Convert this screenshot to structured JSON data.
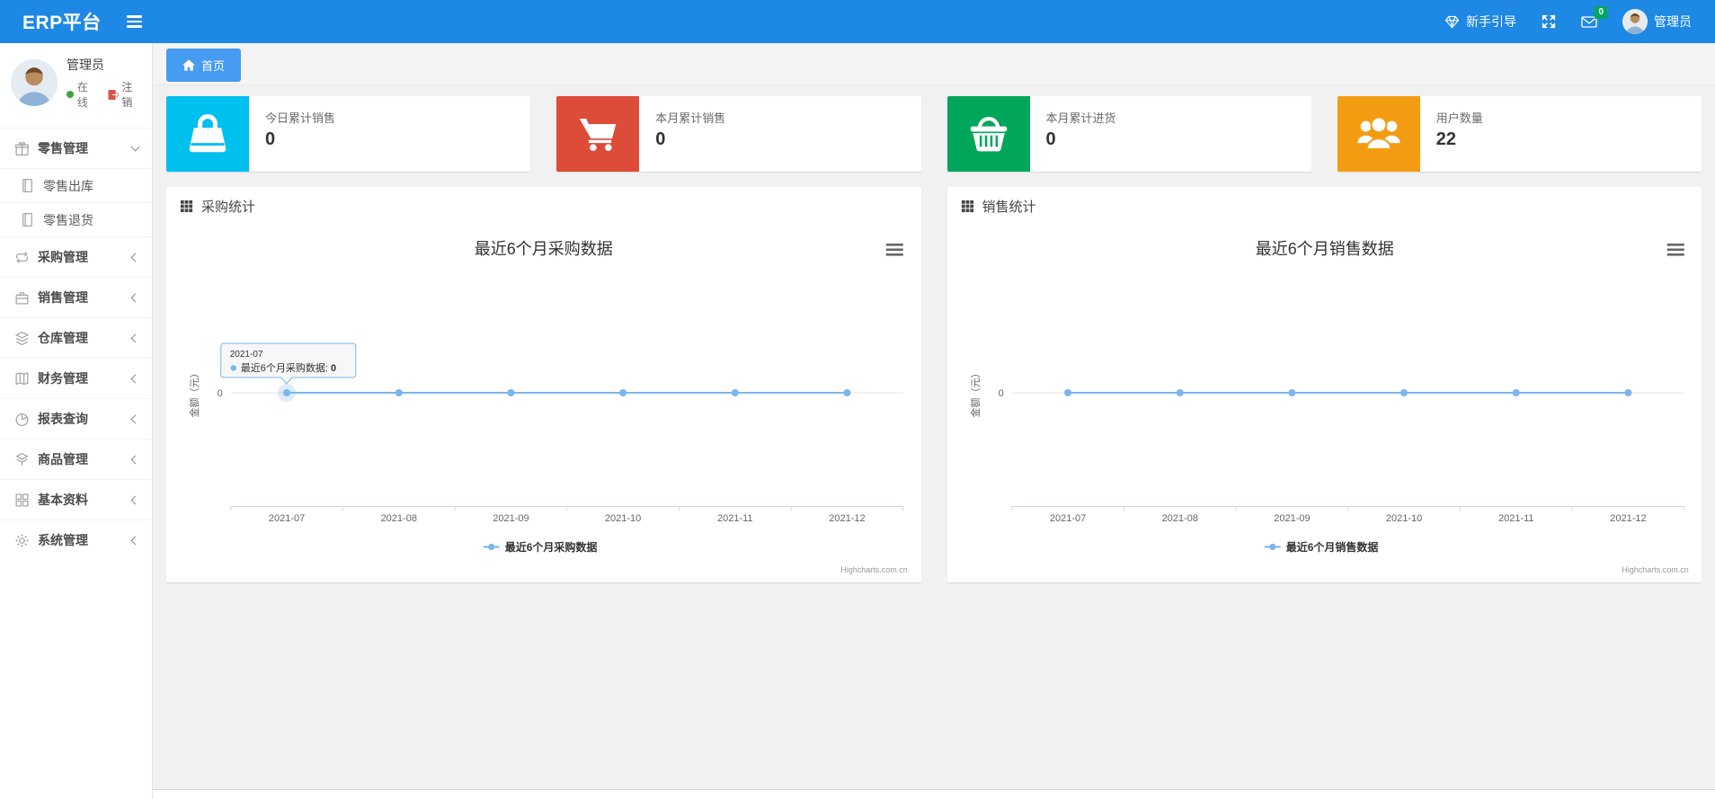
{
  "navbar": {
    "brand": "ERP平台",
    "guide_label": "新手引导",
    "mail_badge": "0",
    "username": "管理员"
  },
  "sidebar": {
    "user": {
      "name": "管理员",
      "status": "在线",
      "logout": "注销"
    },
    "items": [
      {
        "label": "零售管理",
        "icon": "gift-icon",
        "state": "expanded",
        "children": [
          {
            "label": "零售出库"
          },
          {
            "label": "零售退货"
          }
        ]
      },
      {
        "label": "采购管理",
        "icon": "repeat-icon",
        "state": "collapsed"
      },
      {
        "label": "销售管理",
        "icon": "briefcase-icon",
        "state": "collapsed"
      },
      {
        "label": "仓库管理",
        "icon": "layers-icon",
        "state": "collapsed"
      },
      {
        "label": "财务管理",
        "icon": "book-icon",
        "state": "collapsed"
      },
      {
        "label": "报表查询",
        "icon": "pie-chart-icon",
        "state": "collapsed"
      },
      {
        "label": "商品管理",
        "icon": "box-icon",
        "state": "collapsed"
      },
      {
        "label": "基本资料",
        "icon": "grid-icon",
        "state": "collapsed"
      },
      {
        "label": "系统管理",
        "icon": "gear-icon",
        "state": "collapsed"
      }
    ]
  },
  "tabs": [
    {
      "label": "首页",
      "active": true
    }
  ],
  "stat_cards": [
    {
      "label": "今日累计销售",
      "value": "0",
      "color": "#00c0ef",
      "icon": "bag-icon"
    },
    {
      "label": "本月累计销售",
      "value": "0",
      "color": "#dd4b39",
      "icon": "cart-icon"
    },
    {
      "label": "本月累计进货",
      "value": "0",
      "color": "#00a65a",
      "icon": "basket-icon"
    },
    {
      "label": "用户数量",
      "value": "22",
      "color": "#f39c12",
      "icon": "users-icon"
    }
  ],
  "panels": [
    {
      "title": "采购统计"
    },
    {
      "title": "销售统计"
    }
  ],
  "chart_data": [
    {
      "type": "line",
      "title": "最近6个月采购数据",
      "categories": [
        "2021-07",
        "2021-08",
        "2021-09",
        "2021-10",
        "2021-11",
        "2021-12"
      ],
      "series": [
        {
          "name": "最近6个月采购数据",
          "values": [
            0,
            0,
            0,
            0,
            0,
            0
          ]
        }
      ],
      "ylabel": "金额（元）",
      "yticks": [
        "0"
      ],
      "ylim": [
        0,
        1
      ],
      "grid": true,
      "legend_position": "bottom",
      "line_color": "#7cb5ec",
      "credits": "Highcharts.com.cn",
      "tooltip": {
        "category": "2021-07",
        "label": "最近6个月采购数据: ",
        "value": "0"
      }
    },
    {
      "type": "line",
      "title": "最近6个月销售数据",
      "categories": [
        "2021-07",
        "2021-08",
        "2021-09",
        "2021-10",
        "2021-11",
        "2021-12"
      ],
      "series": [
        {
          "name": "最近6个月销售数据",
          "values": [
            0,
            0,
            0,
            0,
            0,
            0
          ]
        }
      ],
      "ylabel": "金额（元）",
      "yticks": [
        "0"
      ],
      "ylim": [
        0,
        1
      ],
      "grid": true,
      "legend_position": "bottom",
      "line_color": "#7cb5ec",
      "credits": "Highcharts.com.cn"
    }
  ]
}
